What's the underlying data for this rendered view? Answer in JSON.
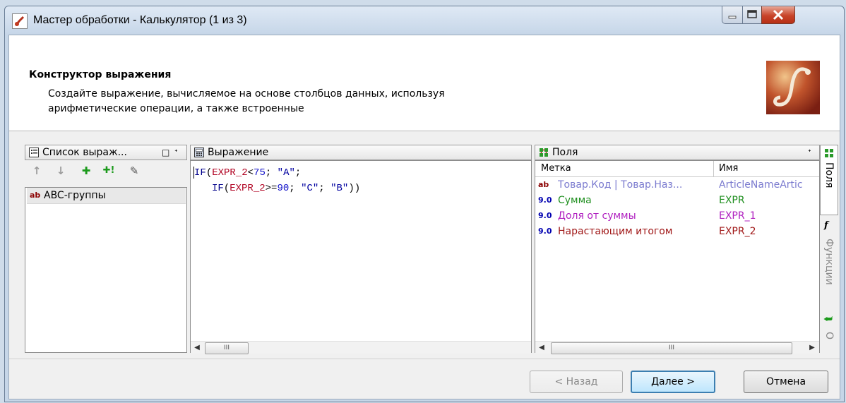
{
  "window": {
    "title": "Мастер обработки - Калькулятор (1 из 3)",
    "controls": {
      "minimize": "_",
      "maximize": "□",
      "close": "X"
    }
  },
  "header": {
    "title": "Конструктор выражения",
    "description": "Создайте выражение, вычисляемое на основе столбцов данных, используя арифметические операции, а также встроенные"
  },
  "expr_list": {
    "title": "Список выраж...",
    "items": [
      {
        "type": "ab",
        "label": "ABC-группы"
      }
    ]
  },
  "expression": {
    "title": "Выражение",
    "line1": {
      "kw": "IF",
      "p1": "(",
      "fld": "EXPR_2",
      "op": "<",
      "num": "75",
      "sep": "; ",
      "str": "\"A\"",
      "end": ";"
    },
    "line2": {
      "kw": "IF",
      "p1": "(",
      "fld": "EXPR_2",
      "op": ">=",
      "num": "90",
      "sep1": "; ",
      "str1": "\"C\"",
      "sep2": "; ",
      "str2": "\"B\"",
      "end": "))"
    }
  },
  "fields": {
    "title": "Поля",
    "columns": [
      "Метка",
      "Имя"
    ],
    "rows": [
      {
        "type": "ab",
        "label": "Товар.Код | Товар.Наз...",
        "name": "ArticleNameArtic",
        "color": "#7b7bcf"
      },
      {
        "type": "9.0",
        "label": "Сумма",
        "name": "EXPR",
        "color": "#1f8f1f"
      },
      {
        "type": "9.0",
        "label": "Доля от суммы",
        "name": "EXPR_1",
        "color": "#b020c0"
      },
      {
        "type": "9.0",
        "label": "Нарастающим итогом",
        "name": "EXPR_2",
        "color": "#a01818"
      }
    ]
  },
  "side_tabs": {
    "fields": "Поля",
    "functions": "Функции",
    "other": "О"
  },
  "buttons": {
    "back": "< Назад",
    "next": "Далее >",
    "cancel": "Отмена"
  },
  "scroll_glyph": "III"
}
